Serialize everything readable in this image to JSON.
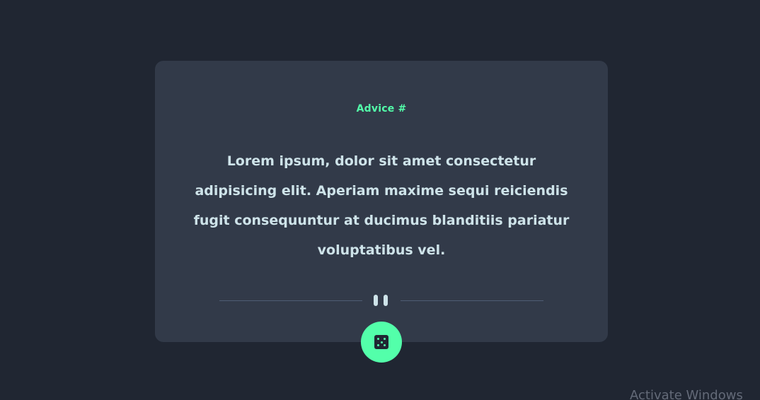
{
  "card": {
    "title": "Advice #",
    "advice": "Lorem ipsum, dolor sit amet consectetur adipisicing elit. Aperiam maxime sequi reiciendis fugit consequuntur at ducimus blanditiis pariatur voluptatibus vel."
  },
  "divider": {
    "icon": "pause-icon"
  },
  "button": {
    "icon": "dice-icon"
  },
  "watermark": {
    "text": "Activate Windows"
  },
  "colors": {
    "background": "#202632",
    "card": "#323a49",
    "accent": "#53ffaa",
    "text": "#cee3e9",
    "divider": "#4f5d74"
  }
}
